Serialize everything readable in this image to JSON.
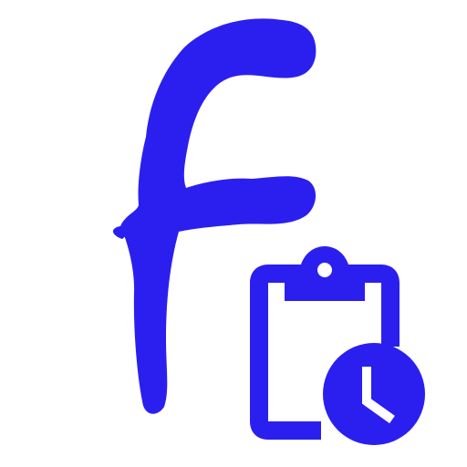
{
  "logo": {
    "letter": "F",
    "letter_icon": "brush-letter-f-icon",
    "badge_icon": "clipboard-clock-icon",
    "color": "#2b1ff0",
    "background": "#ffffff"
  }
}
